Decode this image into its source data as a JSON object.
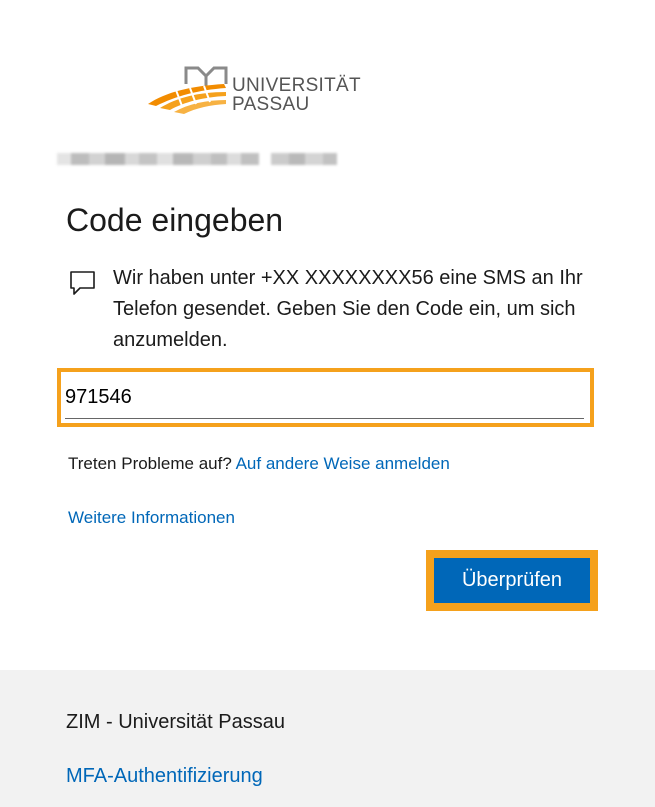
{
  "logo": {
    "line1": "UNIVERSITÄT",
    "line2": "PASSAU",
    "colors": {
      "primary": "#f28c00",
      "text": "#555555"
    }
  },
  "page": {
    "title": "Code eingeben",
    "message": "Wir haben unter +XX XXXXXXXX56 eine SMS an Ihr Telefon gesendet. Geben Sie den Code ein, um sich anzumelden.",
    "message_icon": "chat-bubble-icon"
  },
  "code_input": {
    "value": "971546",
    "placeholder": ""
  },
  "help": {
    "question": "Treten Probleme auf?",
    "alt_link": "Auf andere Weise anmelden",
    "more_info": "Weitere Informationen"
  },
  "actions": {
    "verify_label": "Überprüfen"
  },
  "footer": {
    "org": "ZIM - Universität Passau",
    "link": "MFA-Authentifizierung"
  },
  "colors": {
    "link": "#0067b8",
    "button": "#0067b8",
    "highlight": "#f5a11c",
    "footer_bg": "#f2f2f2"
  }
}
